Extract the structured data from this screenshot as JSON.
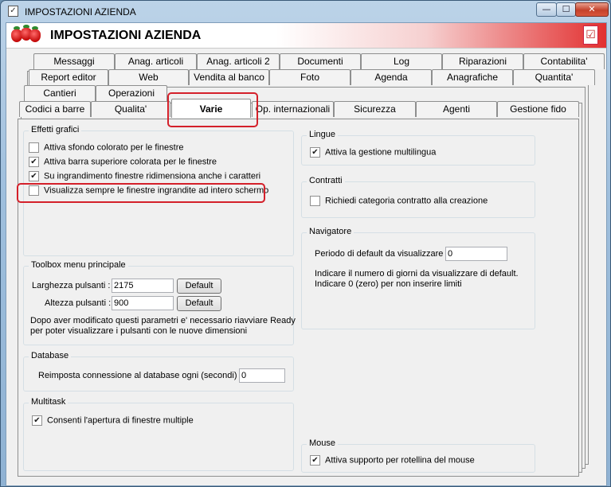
{
  "window": {
    "title": "IMPOSTAZIONI AZIENDA",
    "buttons": {
      "minimize": "—",
      "maximize": "☐",
      "close": "✕"
    }
  },
  "banner": {
    "title": "IMPOSTAZIONI AZIENDA",
    "checkmark": "☑"
  },
  "tabs": {
    "row1": [
      "Messaggi",
      "Anag. articoli",
      "Anag. articoli 2",
      "Documenti",
      "Log",
      "Riparazioni",
      "Contabilita'"
    ],
    "row2": [
      "Report editor",
      "Web",
      "Vendita al banco",
      "Foto",
      "Agenda",
      "Anagrafiche",
      "Quantita'"
    ],
    "row3": [
      "Cantieri",
      "Operazioni"
    ],
    "row4": [
      "Codici a barre",
      "Qualita'",
      "Varie",
      "Op. internazionali",
      "Sicurezza",
      "Agenti",
      "Gestione fido"
    ],
    "active": "Varie"
  },
  "effetti": {
    "title": "Effetti grafici",
    "items": [
      {
        "label": "Attiva sfondo colorato per le finestre",
        "checked": false
      },
      {
        "label": "Attiva barra superiore colorata per le finestre",
        "checked": true
      },
      {
        "label": "Su ingrandimento finestre ridimensiona anche i caratteri",
        "checked": true
      },
      {
        "label": "Visualizza sempre le finestre ingrandite ad intero schermo",
        "checked": false
      }
    ]
  },
  "toolbox": {
    "title": "Toolbox menu principale",
    "width_label": "Larghezza pulsanti :",
    "width_value": "2175",
    "height_label": "Altezza pulsanti :",
    "height_value": "900",
    "default_label": "Default",
    "note_line1": "Dopo aver modificato questi parametri e' necessario riavviare Ready",
    "note_line2": "per poter visualizzare i pulsanti con le nuove dimensioni"
  },
  "database": {
    "title": "Database",
    "label": "Reimposta connessione al database ogni (secondi) :",
    "value": "0"
  },
  "multitask": {
    "title": "Multitask",
    "label": "Consenti l'apertura di finestre multiple",
    "checked": true
  },
  "lingue": {
    "title": "Lingue",
    "label": "Attiva la gestione multilingua",
    "checked": true
  },
  "contratti": {
    "title": "Contratti",
    "label": "Richiedi categoria contratto alla creazione",
    "checked": false
  },
  "navigatore": {
    "title": "Navigatore",
    "label": "Periodo di default da visualizzare :",
    "value": "0",
    "note_line1": "Indicare il numero di giorni da visualizzare di default.",
    "note_line2": "Indicare 0 (zero) per non inserire limiti"
  },
  "mouse": {
    "title": "Mouse",
    "label": "Attiva supporto per rotellina del mouse",
    "checked": true
  }
}
